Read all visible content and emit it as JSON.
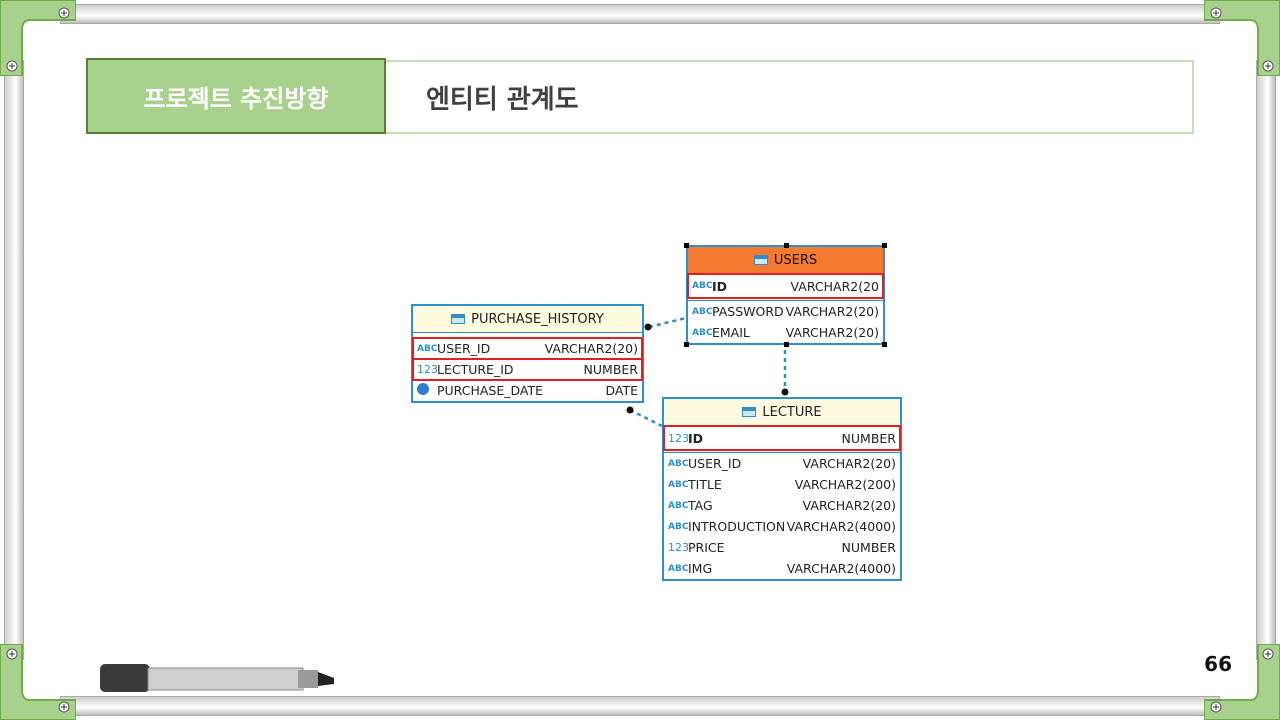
{
  "header": {
    "section_label": "프로젝트 추진방향",
    "slide_title": "엔티티 관계도"
  },
  "page_number": "66",
  "colors": {
    "section_bg": "#a9d18e",
    "table_border": "#2e8fca",
    "users_header": "#f47a30",
    "highlight": "#e02020"
  },
  "er": {
    "purchase_history": {
      "name": "PURCHASE_HISTORY",
      "columns": [
        {
          "icon": "ABC",
          "name": "USER_ID",
          "type": "VARCHAR2(20)"
        },
        {
          "icon": "123",
          "name": "LECTURE_ID",
          "type": "NUMBER"
        },
        {
          "icon": "clock-icon",
          "name": "PURCHASE_DATE",
          "type": "DATE"
        }
      ]
    },
    "users": {
      "name": "USERS",
      "columns": [
        {
          "icon": "ABC",
          "name": "ID",
          "type": "VARCHAR2(20"
        },
        {
          "icon": "ABC",
          "name": "PASSWORD",
          "type": "VARCHAR2(20)"
        },
        {
          "icon": "ABC",
          "name": "EMAIL",
          "type": "VARCHAR2(20)"
        }
      ]
    },
    "lecture": {
      "name": "LECTURE",
      "columns": [
        {
          "icon": "123",
          "name": "ID",
          "type": "NUMBER"
        },
        {
          "icon": "ABC",
          "name": "USER_ID",
          "type": "VARCHAR2(20)"
        },
        {
          "icon": "ABC",
          "name": "TITLE",
          "type": "VARCHAR2(200)"
        },
        {
          "icon": "ABC",
          "name": "TAG",
          "type": "VARCHAR2(20)"
        },
        {
          "icon": "ABC",
          "name": "INTRODUCTION",
          "type": "VARCHAR2(4000)"
        },
        {
          "icon": "123",
          "name": "PRICE",
          "type": "NUMBER"
        },
        {
          "icon": "ABC",
          "name": "IMG",
          "type": "VARCHAR2(4000)"
        }
      ]
    }
  }
}
